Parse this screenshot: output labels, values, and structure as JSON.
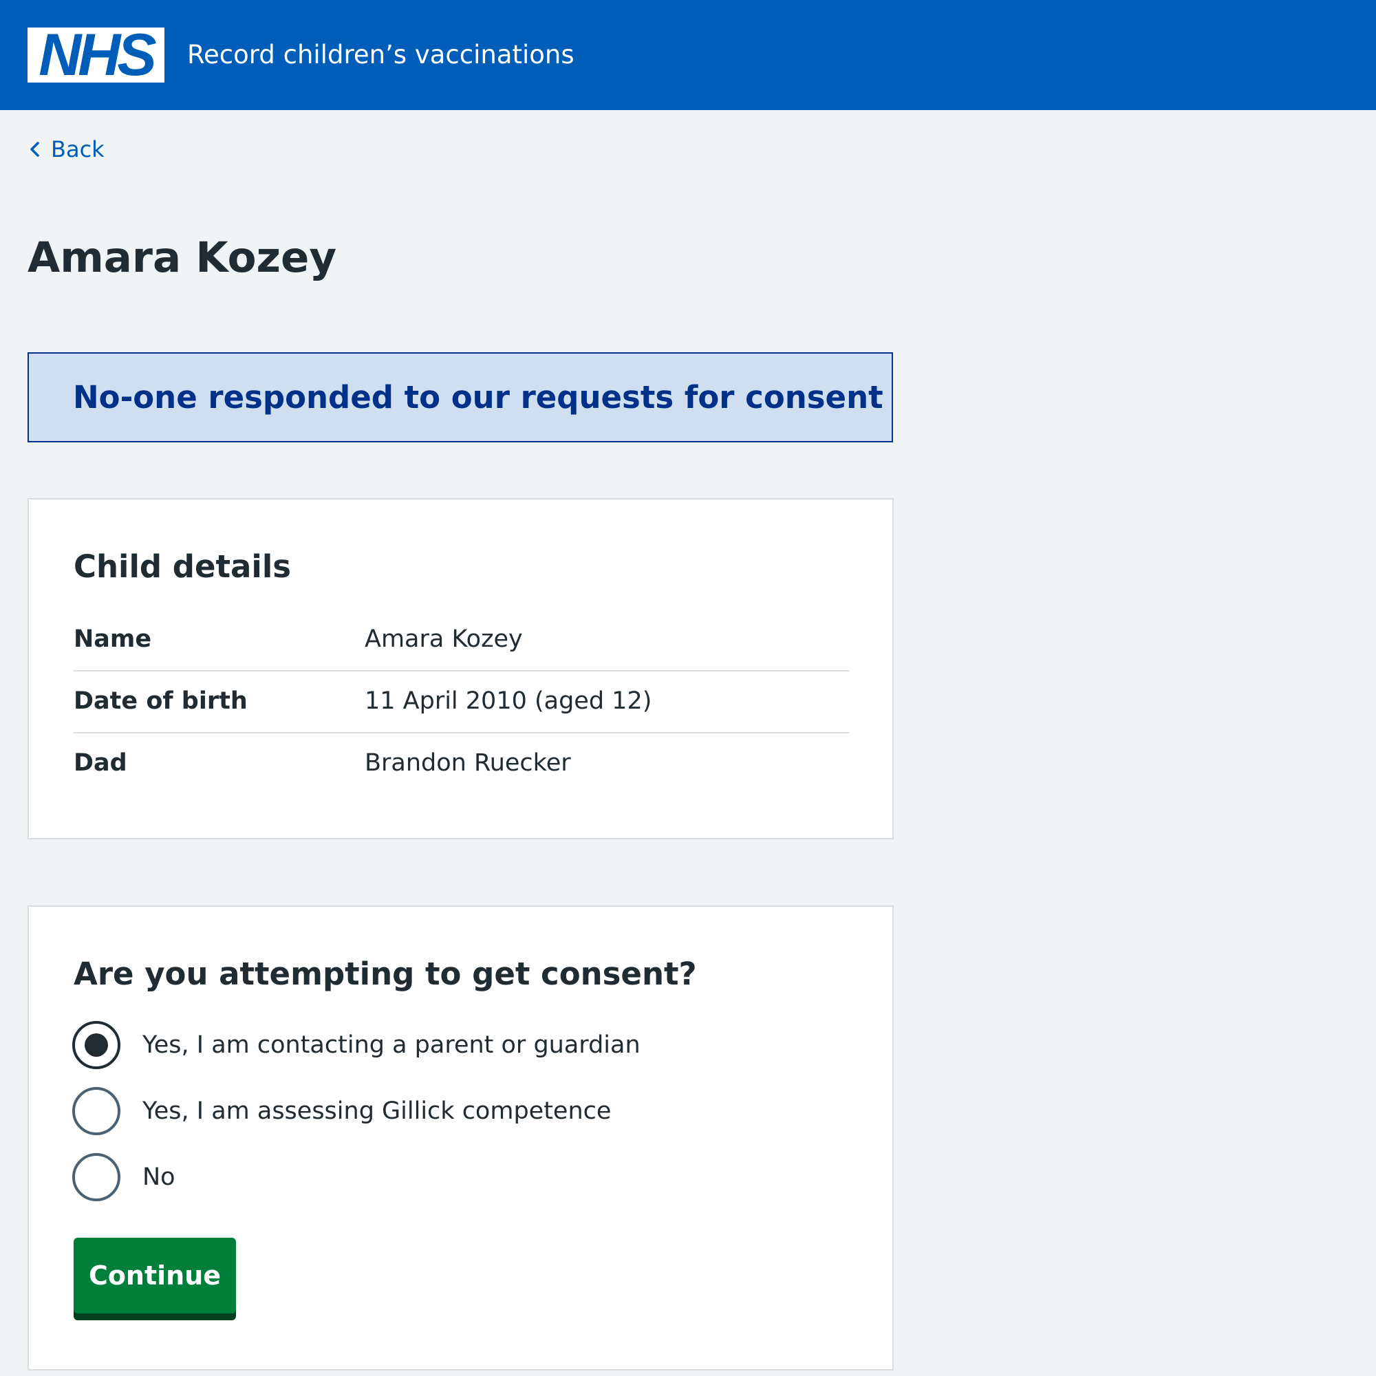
{
  "header": {
    "logo_text": "NHS",
    "service_name": "Record children’s vaccinations"
  },
  "nav": {
    "back_label": "Back"
  },
  "page": {
    "title": "Amara Kozey"
  },
  "notice": {
    "text": "No-one responded to our requests for consent"
  },
  "child_details": {
    "heading": "Child details",
    "rows": [
      {
        "key": "Name",
        "value": "Amara Kozey"
      },
      {
        "key": "Date of birth",
        "value": "11 April 2010 (aged 12)"
      },
      {
        "key": "Dad",
        "value": "Brandon Ruecker"
      }
    ]
  },
  "consent_question": {
    "question": "Are you attempting to get consent?",
    "options": [
      {
        "label": "Yes, I am contacting a parent or guardian",
        "selected": true
      },
      {
        "label": "Yes, I am assessing Gillick competence",
        "selected": false
      },
      {
        "label": "No",
        "selected": false
      }
    ],
    "continue_label": "Continue"
  },
  "colors": {
    "brand_blue": "#005eb8",
    "page_background": "#f0f4f5",
    "notice_background": "#cfdff0",
    "notice_text": "#003087",
    "button_green": "#007f3b",
    "text": "#212b32"
  },
  "icons": {
    "back": "chevron-left-icon"
  }
}
